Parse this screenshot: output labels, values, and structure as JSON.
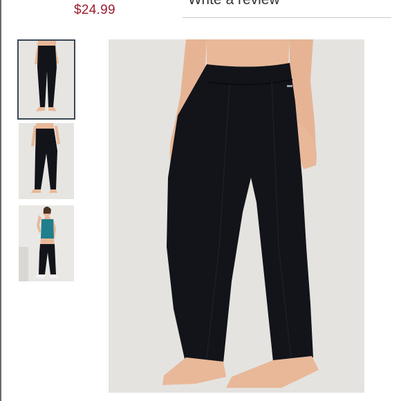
{
  "product": {
    "price": "$24.99",
    "review_link": "Write a review"
  },
  "gallery": {
    "selected_index": 0,
    "thumbnails": [
      {
        "icon": "pants-front-view-image"
      },
      {
        "icon": "pants-angle-view-image"
      },
      {
        "icon": "model-teal-tank-image"
      }
    ]
  },
  "colors": {
    "price": "#9b1c2e",
    "pants": "#12141a",
    "skin": "#e8b899",
    "tank": "#1f7f8c",
    "backdrop": "#e4e3df",
    "selected_outline": "#3b4654"
  }
}
